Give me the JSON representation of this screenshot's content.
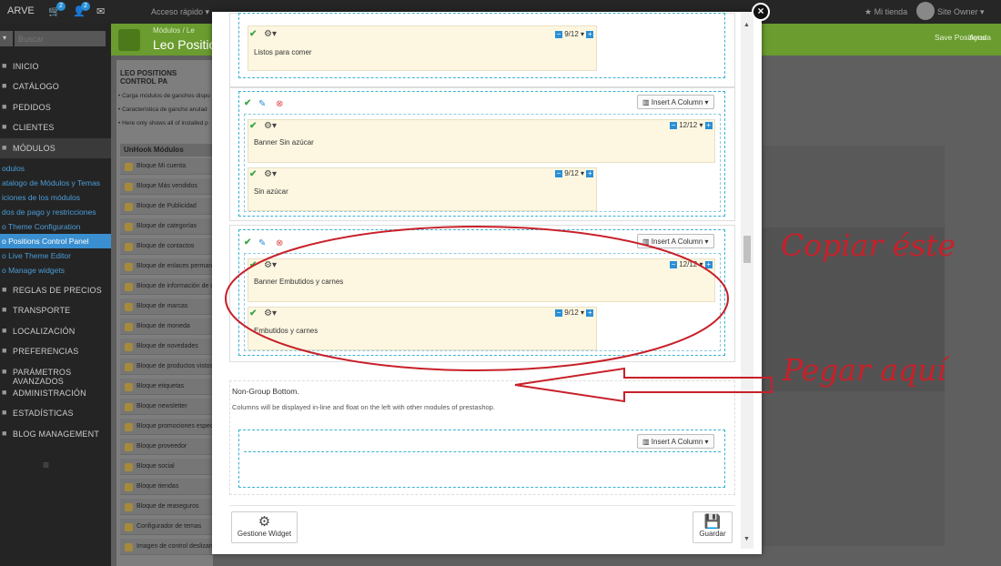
{
  "topbar": {
    "brand": "ARVE",
    "cart_count": "2",
    "user_count": "2",
    "quick_access": "Acceso rápido ▾",
    "my_store": "★ Mi tienda",
    "owner": "Site Owner ▾"
  },
  "sidebar": {
    "search_placeholder": "Buscar",
    "search_toggle": "▾",
    "items": [
      {
        "label": "Inicio"
      },
      {
        "label": "Catálogo"
      },
      {
        "label": "Pedidos"
      },
      {
        "label": "Clientes"
      },
      {
        "label": "Módulos"
      },
      {
        "label": "Reglas de precios"
      },
      {
        "label": "Transporte"
      },
      {
        "label": "Localización"
      },
      {
        "label": "Preferencias"
      },
      {
        "label": "Parámetros avanzados"
      },
      {
        "label": "Administración"
      },
      {
        "label": "Estadísticas"
      },
      {
        "label": "Blog Management"
      }
    ],
    "subitems": [
      {
        "label": "odulos"
      },
      {
        "label": "atalogo de Módulos y Temas"
      },
      {
        "label": "iciones de los módulos"
      },
      {
        "label": "dos de pago y restricciones"
      },
      {
        "label": "o Theme Configuration"
      },
      {
        "label": "o Positions Control Panel"
      },
      {
        "label": "o Live Theme Editor"
      },
      {
        "label": "o Manage widgets"
      }
    ]
  },
  "header": {
    "breadcrumb": "Módulos   /   Le",
    "title": "Leo Position",
    "save_positions": "Save Positions",
    "help": "Ayuda"
  },
  "left_panel": {
    "title": "LEO POSITIONS CONTROL PA",
    "notes": [
      "• Carga módulos de ganchos dispo",
      "• Característica de gancho anulad",
      "• Here only shows all of installed p"
    ],
    "unhook_title": "UnHook Módulos",
    "modules": [
      "Bloque Mi cuenta",
      "Bloque Más vendidos",
      "Bloque de Publicidad",
      "Bloque de categorías",
      "Bloque de contactos",
      "Bloque de enlaces permanentes",
      "Bloque de información de contacto",
      "Bloque de marcas",
      "Bloque de moneda",
      "Bloque de novedades",
      "Bloque de productos vistos",
      "Bloque etiquetas",
      "Bloque newsletter",
      "Bloque promociones especiales",
      "Bloque proveedor",
      "Bloque social",
      "Bloque tiendas",
      "Bloque de reaseguros",
      "Configurador de temas",
      "Imagen de control deslizante"
    ]
  },
  "modal": {
    "close": "×",
    "group1": {
      "col_text": "Listos para comer",
      "col_width": "9/12"
    },
    "group2": {
      "insert_label": "Insert A Column",
      "col1_text": "Banner Sin azúcar",
      "col1_width": "12/12",
      "col2_text": "Sin azúcar",
      "col2_width": "9/12"
    },
    "group3": {
      "insert_label": "Insert A Column",
      "col1_text": "Banner Embutidos y carnes",
      "col1_width": "12/12",
      "col2_text": "Embutidos y carnes",
      "col2_width": "9/12"
    },
    "nongroup": {
      "title": "Non-Group Bottom.",
      "description": "Columns will be displayed in-line and float on the left with other modules of prestashop.",
      "insert_label": "Insert A Column"
    },
    "footer": {
      "widget_button": "Gestione Widget",
      "save_button": "Guardar"
    }
  },
  "annotations": {
    "copy": "Copiar éste",
    "paste": "Pegar aquí",
    "color": "#c8202a"
  },
  "icons": {
    "check": "check-icon",
    "gear": "gear-icon",
    "edit": "edit-icon",
    "delete": "delete-icon",
    "minus": "minus-icon",
    "plus": "plus-icon"
  }
}
